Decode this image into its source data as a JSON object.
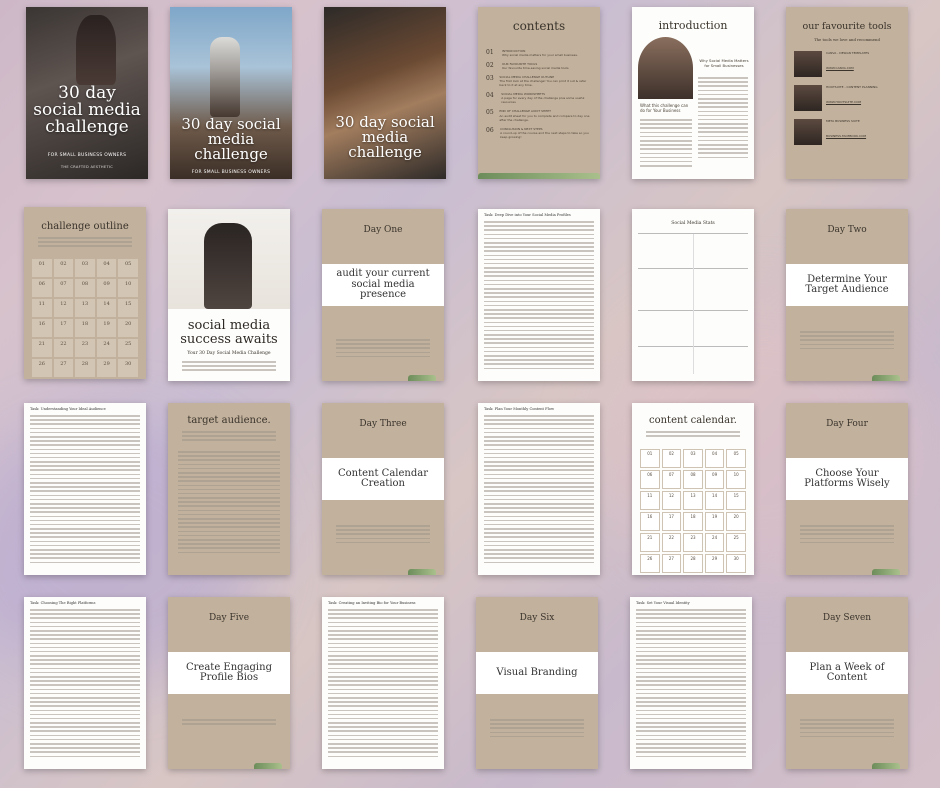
{
  "covers": {
    "c1": {
      "title": "30 day social media challenge",
      "subtitle": "FOR SMALL BUSINESS OWNERS",
      "brand": "THE CRAFTED AESTHETIC"
    },
    "c2": {
      "title": "30 day social media challenge",
      "subtitle": "FOR SMALL BUSINESS OWNERS"
    },
    "c3": {
      "title": "30 day social media challenge"
    }
  },
  "contents": {
    "title": "contents",
    "items": [
      {
        "num": "01",
        "heading": "INTRODUCTION",
        "text": "Why social media matters for your small business."
      },
      {
        "num": "02",
        "heading": "OUR FAVOURITE TOOLS",
        "text": "Our favourite time-saving social media tools"
      },
      {
        "num": "03",
        "heading": "SOCIAL MEDIA CHALLENGE OUTLINE",
        "text": "The first look at the challenge! You can print it out & refer back to it at any time."
      },
      {
        "num": "04",
        "heading": "SOCIAL MEDIA WORKSHEETS",
        "text": "A page for every day of the challenge plus some useful resources"
      },
      {
        "num": "05",
        "heading": "END OF CHALLENGE AUDIT SHEET",
        "text": "An audit sheet for you to complete and compare to day one after the challenge."
      },
      {
        "num": "06",
        "heading": "CONCLUSION & NEXT STEPS",
        "text": "A round-up of the course and the next steps to take so you keep growing!"
      }
    ]
  },
  "introduction": {
    "title": "introduction",
    "side_heading": "Why Social Media Matters for Small Businesses",
    "caption": "What this challenge can do for Your Business"
  },
  "tools": {
    "title": "our favourite tools",
    "subtitle": "The tools we love and recommend",
    "items": [
      {
        "name": "CANVA - DESIGN TEMPLATES",
        "link": "WWW.CANVA.COM"
      },
      {
        "name": "HOOTSUITE - CONTENT PLANNING",
        "link": "WWW.HOOTSUITE.COM"
      },
      {
        "name": "META BUSINESS SUITE",
        "link": "BUSINESS.FACEBOOK.COM"
      }
    ]
  },
  "outline": {
    "title": "challenge outline",
    "days": [
      "01",
      "02",
      "03",
      "04",
      "05",
      "06",
      "07",
      "08",
      "09",
      "10",
      "11",
      "12",
      "13",
      "14",
      "15",
      "16",
      "17",
      "18",
      "19",
      "20",
      "21",
      "22",
      "23",
      "24",
      "25",
      "26",
      "27",
      "28",
      "29",
      "30"
    ]
  },
  "success": {
    "title": "social media success awaits",
    "subtitle": "Your 30 Day Social Media Challenge"
  },
  "day1": {
    "label": "Day One",
    "title": "audit your current social media presence"
  },
  "task1": {
    "title": "Task: Deep Dive into Your Social Media Profiles"
  },
  "stats": {
    "title": "Social Media Stats"
  },
  "day2": {
    "label": "Day Two",
    "title": "Determine Your Target Audience"
  },
  "task2": {
    "title": "Task: Understanding Your Ideal Audience"
  },
  "target": {
    "title": "target audience."
  },
  "day3": {
    "label": "Day Three",
    "title": "Content Calendar Creation"
  },
  "task3": {
    "title": "Task: Plan Your Monthly Content Flow"
  },
  "calendar": {
    "title": "content calendar.",
    "dates": [
      "01",
      "02",
      "03",
      "04",
      "05",
      "06",
      "07",
      "08",
      "09",
      "10",
      "11",
      "12",
      "13",
      "14",
      "15",
      "16",
      "17",
      "18",
      "19",
      "20",
      "21",
      "22",
      "23",
      "24",
      "25",
      "26",
      "27",
      "28",
      "29",
      "30"
    ]
  },
  "day4": {
    "label": "Day Four",
    "title": "Choose Your Platforms Wisely"
  },
  "task4": {
    "title": "Task: Choosing The Right Platforms"
  },
  "day5": {
    "label": "Day Five",
    "title": "Create Engaging Profile Bios"
  },
  "task5": {
    "title": "Task: Creating an Inviting Bio for Your Business"
  },
  "day6": {
    "label": "Day Six",
    "title": "Visual Branding"
  },
  "task6": {
    "title": "Task: Set Your Visual Identity"
  },
  "day7": {
    "label": "Day Seven",
    "title": "Plan a Week of Content"
  },
  "colors": {
    "tan": "#c2b19c",
    "white": "#fdfdfb",
    "text": "#3a342c",
    "leaf": "#6c8d5a"
  }
}
